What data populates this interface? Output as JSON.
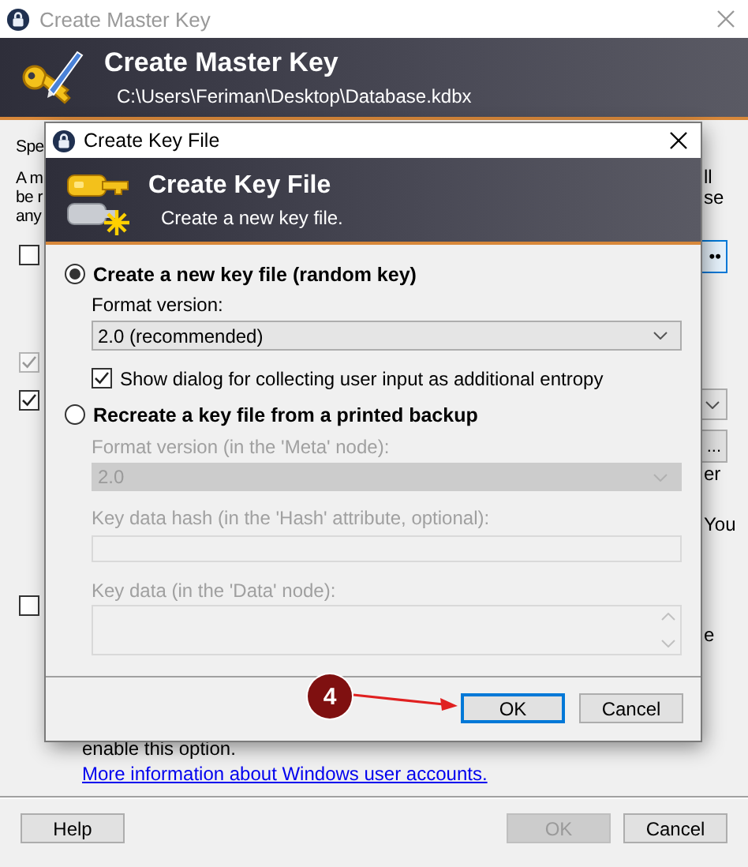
{
  "master_window": {
    "title": "Create Master Key",
    "header": {
      "title": "Create Master Key",
      "subtitle": "C:\\Users\\Feriman\\Desktop\\Database.kdbx"
    },
    "left_items": [
      {
        "kind": "text",
        "text": "Spe"
      },
      {
        "kind": "text",
        "text": "A m"
      },
      {
        "kind": "text",
        "text": "be r"
      },
      {
        "kind": "text",
        "text": "any"
      },
      {
        "kind": "checkbox",
        "checked": false,
        "disabled": false
      },
      {
        "kind": "checkbox",
        "checked": true,
        "disabled": true
      },
      {
        "kind": "checkbox",
        "checked": true,
        "disabled": false
      },
      {
        "kind": "checkbox",
        "checked": false,
        "disabled": false
      }
    ],
    "right_items": [
      {
        "kind": "text",
        "text": "ll"
      },
      {
        "kind": "text",
        "text": "se"
      },
      {
        "kind": "button",
        "text": "••"
      },
      {
        "kind": "dropdown"
      },
      {
        "kind": "button",
        "text": "..."
      },
      {
        "kind": "text",
        "text": "er"
      },
      {
        "kind": "text",
        "text": "You"
      },
      {
        "kind": "text",
        "text": "e"
      }
    ],
    "note": "enable this option.",
    "link": "More information about Windows user accounts.",
    "buttons": [
      {
        "label": "Help",
        "disabled": false
      },
      {
        "label": "OK",
        "disabled": true
      },
      {
        "label": "Cancel",
        "disabled": false
      }
    ]
  },
  "dialog": {
    "title": "Create Key File",
    "header": {
      "title": "Create Key File",
      "subtitle": "Create a new key file."
    },
    "modes": [
      {
        "label": "Create a new key file (random key)",
        "selected": true,
        "format_label": "Format version:",
        "format_value": "2.0 (recommended)",
        "entropy": {
          "label": "Show dialog for collecting user input as additional entropy",
          "checked": true
        }
      },
      {
        "label": "Recreate a key file from a printed backup",
        "selected": false,
        "format_label": "Format version (in the 'Meta' node):",
        "format_value": "2.0",
        "hash_label": "Key data hash (in the 'Hash' attribute, optional):",
        "data_label": "Key data (in the 'Data' node):"
      }
    ],
    "buttons": [
      {
        "label": "OK",
        "focused": true
      },
      {
        "label": "Cancel",
        "focused": false
      }
    ]
  },
  "annotation": {
    "number": "4"
  }
}
